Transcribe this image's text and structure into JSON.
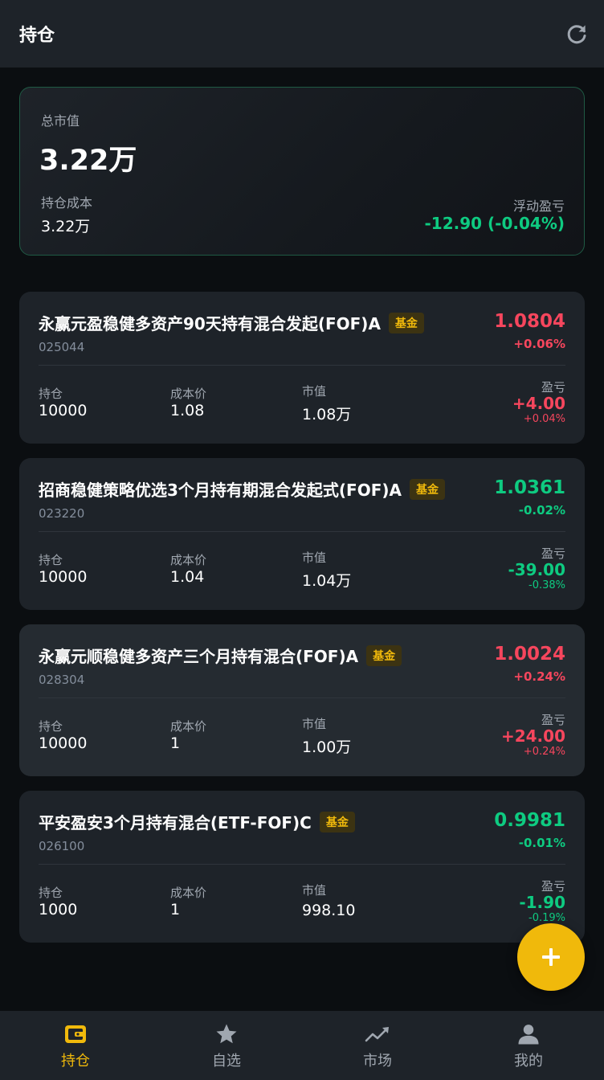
{
  "header": {
    "title": "持仓"
  },
  "summary": {
    "total_label": "总市值",
    "total_value": "3.22万",
    "cost_label": "持仓成本",
    "cost_value": "3.22万",
    "pnl_label": "浮动盈亏",
    "pnl_value": "-12.90 (-0.04%)"
  },
  "labels": {
    "holding": "持仓",
    "cost_price": "成本价",
    "market_value": "市值",
    "pnl": "盈亏"
  },
  "holdings": [
    {
      "name": "永赢元盈稳健多资产90天持有混合发起(FOF)A",
      "badge": "基金",
      "code": "025044",
      "nav": "1.0804",
      "nav_change": "+0.06%",
      "shares": "10000",
      "cost_price": "1.08",
      "market_value": "1.08万",
      "pnl": "+4.00",
      "pnl_pct": "+0.04%",
      "direction": "up"
    },
    {
      "name": "招商稳健策略优选3个月持有期混合发起式(FOF)A",
      "badge": "基金",
      "code": "023220",
      "nav": "1.0361",
      "nav_change": "-0.02%",
      "shares": "10000",
      "cost_price": "1.04",
      "market_value": "1.04万",
      "pnl": "-39.00",
      "pnl_pct": "-0.38%",
      "direction": "down"
    },
    {
      "name": "永赢元顺稳健多资产三个月持有混合(FOF)A",
      "badge": "基金",
      "code": "028304",
      "nav": "1.0024",
      "nav_change": "+0.24%",
      "shares": "10000",
      "cost_price": "1",
      "market_value": "1.00万",
      "pnl": "+24.00",
      "pnl_pct": "+0.24%",
      "direction": "up"
    },
    {
      "name": "平安盈安3个月持有混合(ETF-FOF)C",
      "badge": "基金",
      "code": "026100",
      "nav": "0.9981",
      "nav_change": "-0.01%",
      "shares": "1000",
      "cost_price": "1",
      "market_value": "998.10",
      "pnl": "-1.90",
      "pnl_pct": "-0.19%",
      "direction": "down"
    }
  ],
  "fab": {
    "icon": "plus-icon"
  },
  "bottom_nav": [
    {
      "label": "持仓",
      "icon": "wallet-icon",
      "active": true
    },
    {
      "label": "自选",
      "icon": "star-icon",
      "active": false
    },
    {
      "label": "市场",
      "icon": "trend-icon",
      "active": false
    },
    {
      "label": "我的",
      "icon": "user-icon",
      "active": false
    }
  ],
  "colors": {
    "accent": "#f0b90b",
    "up": "#f6465d",
    "down": "#0ecb81",
    "background": "#0b0e11",
    "card": "#1e2329"
  }
}
